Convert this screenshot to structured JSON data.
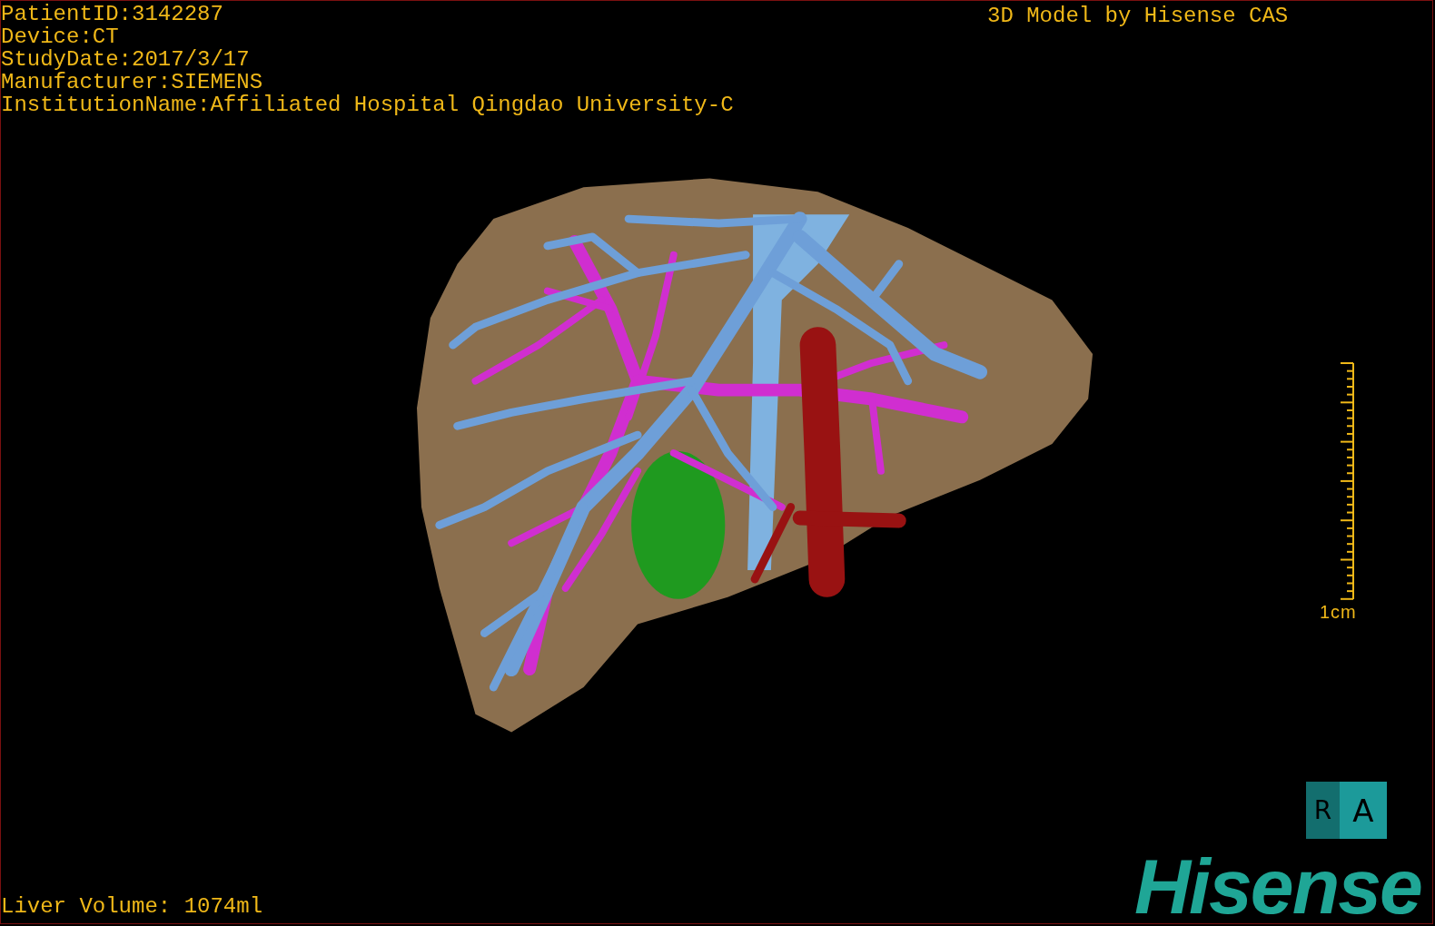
{
  "header": {
    "lines": [
      "PatientID:3142287",
      "Device:CT",
      "StudyDate:2017/3/17",
      "Manufacturer:SIEMENS",
      "InstitutionName:Affiliated Hospital Qingdao University-C"
    ]
  },
  "credit": "3D Model by Hisense CAS",
  "scale_bar": {
    "label": "1cm"
  },
  "orientation_cube": {
    "side": "R",
    "front": "A"
  },
  "footer": {
    "liver_volume": "Liver Volume: 1074ml"
  },
  "logo": {
    "text": "Hisense"
  }
}
